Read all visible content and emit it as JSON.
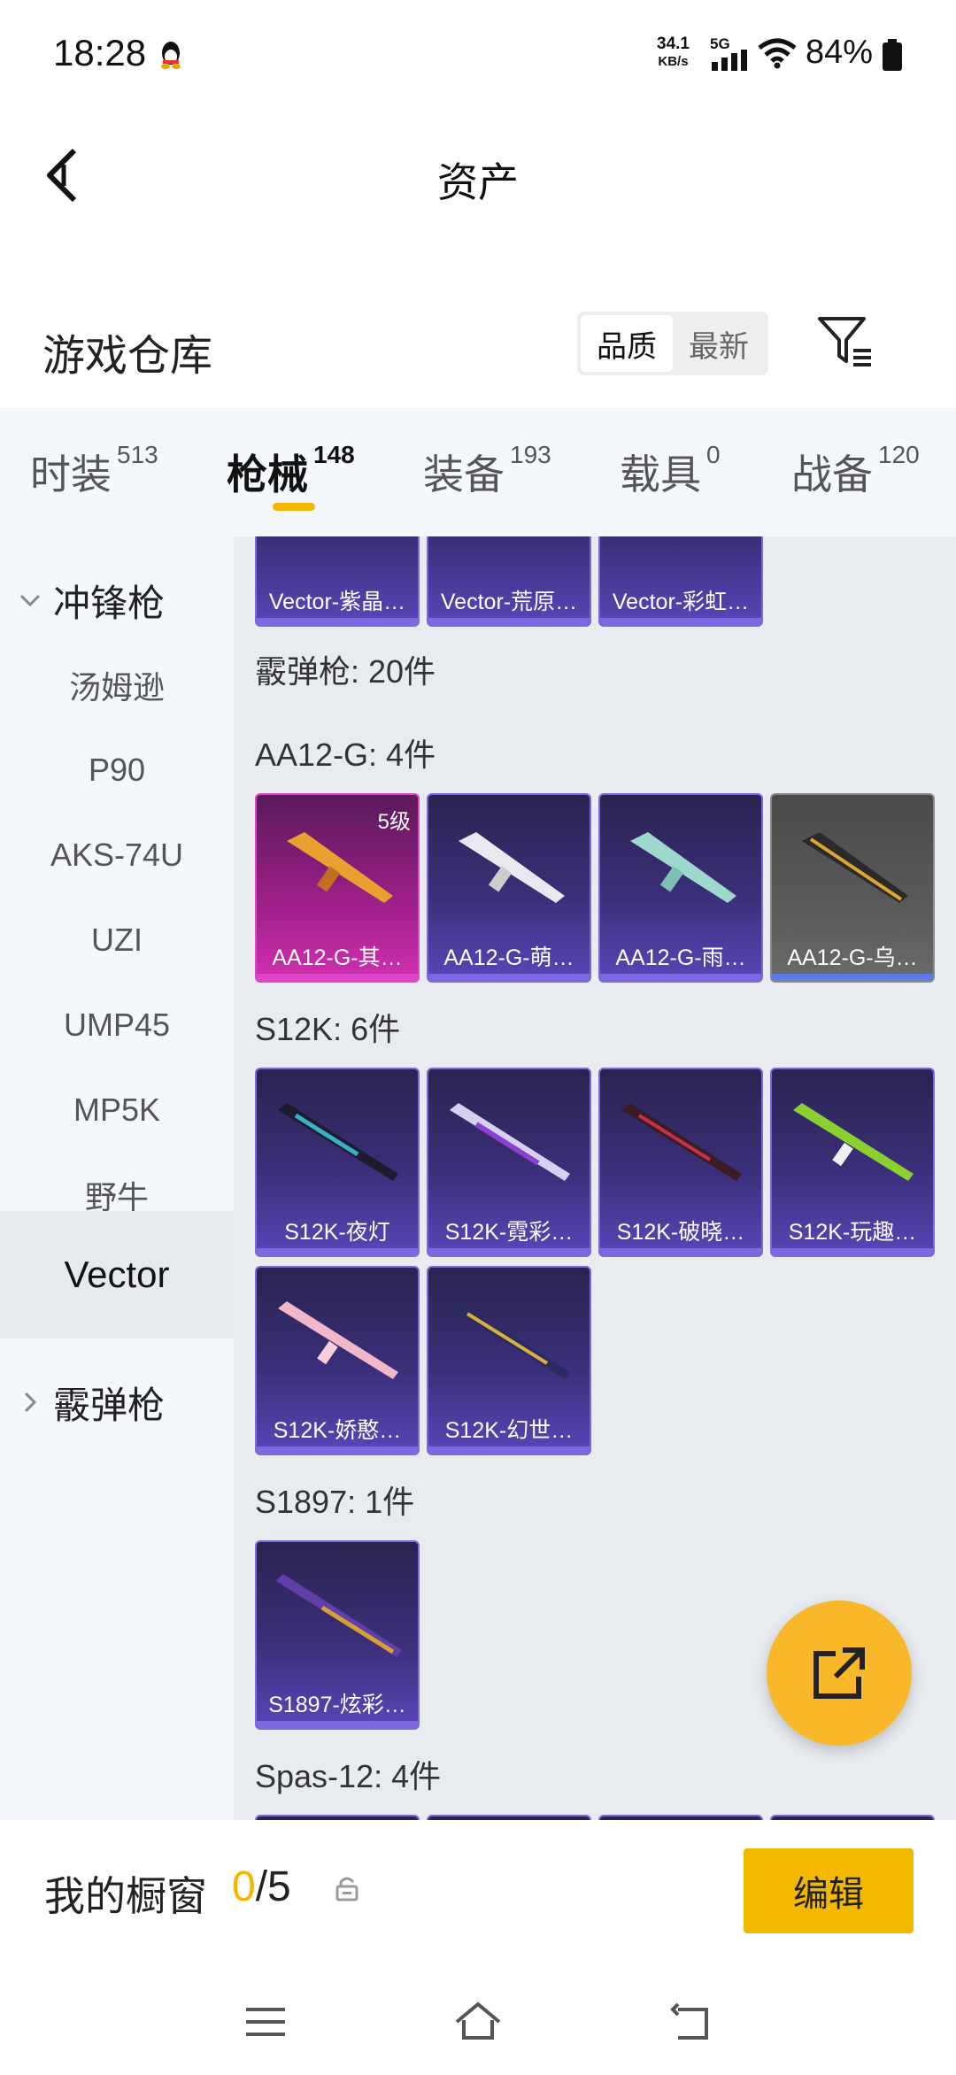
{
  "status": {
    "time": "18:28",
    "speed_value": "34.1",
    "speed_unit": "KB/s",
    "network": "5G",
    "battery": "84%"
  },
  "header": {
    "title": "资产"
  },
  "warehouse": {
    "title": "游戏仓库",
    "sort": [
      "品质",
      "最新"
    ]
  },
  "tabs": [
    {
      "label": "时装",
      "count": "513"
    },
    {
      "label": "枪械",
      "count": "148"
    },
    {
      "label": "装备",
      "count": "193"
    },
    {
      "label": "载具",
      "count": "0"
    },
    {
      "label": "战备",
      "count": "120"
    }
  ],
  "sidebar": {
    "group_open": "冲锋枪",
    "items": [
      "汤姆逊",
      "P90",
      "AKS-74U",
      "UZI",
      "UMP45",
      "MP5K",
      "野牛",
      "Vector"
    ],
    "group_closed": "霰弹枪"
  },
  "content": {
    "top_row": [
      "Vector-紫晶…",
      "Vector-荒原…",
      "Vector-彩虹…"
    ],
    "sec_shotgun": "霰弹枪: 20件",
    "sec_aa12": "AA12-G: 4件",
    "aa12": [
      "AA12-G-其…",
      "AA12-G-萌…",
      "AA12-G-雨…",
      "AA12-G-乌…"
    ],
    "aa12_level": "5级",
    "sec_s12k": "S12K: 6件",
    "s12k": [
      "S12K-夜灯",
      "S12K-霓彩…",
      "S12K-破晓…",
      "S12K-玩趣…",
      "S12K-娇憨…",
      "S12K-幻世…"
    ],
    "sec_s1897": "S1897: 1件",
    "s1897": [
      "S1897-炫彩…"
    ],
    "sec_spas": "Spas-12: 4件"
  },
  "bottom": {
    "label": "我的橱窗",
    "count_current": "0",
    "count_total": "/5",
    "edit": "编辑"
  },
  "colors": {
    "accent": "#f5b400",
    "tile": "#3b2f7a",
    "tile_pink": "#d030b0"
  }
}
